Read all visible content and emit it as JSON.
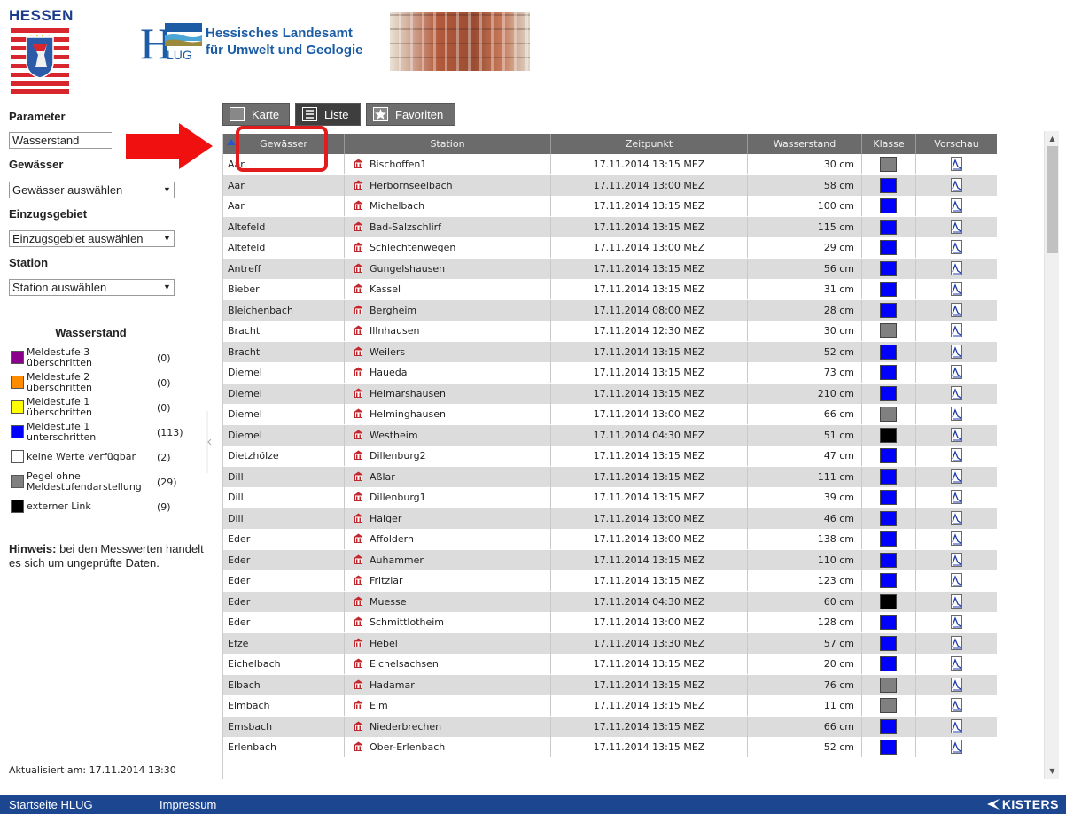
{
  "header": {
    "state_name": "HESSEN",
    "agency_abbrev_main": "H",
    "agency_abbrev_sub": "LUG",
    "agency_name_line1": "Hessisches Landesamt",
    "agency_name_line2": "für Umwelt und Geologie"
  },
  "sidebar": {
    "parameter_label": "Parameter",
    "parameter_value": "Wasserstand",
    "gewaesser_label": "Gewässer",
    "gewaesser_value": "Gewässer auswählen",
    "einzugsgebiet_label": "Einzugsgebiet",
    "einzugsgebiet_value": "Einzugsgebiet auswählen",
    "station_label": "Station",
    "station_value": "Station auswählen",
    "legend_title": "Wasserstand",
    "legend": [
      {
        "line1": "Meldestufe 3",
        "line2": "überschritten",
        "count": "(0)",
        "color": "#8b008b"
      },
      {
        "line1": "Meldestufe 2",
        "line2": "überschritten",
        "count": "(0)",
        "color": "#ff8c00"
      },
      {
        "line1": "Meldestufe 1",
        "line2": "überschritten",
        "count": "(0)",
        "color": "#ffff00"
      },
      {
        "line1": "Meldestufe 1",
        "line2": "unterschritten",
        "count": "(113)",
        "color": "#0000ff"
      },
      {
        "line1": "keine Werte verfügbar",
        "line2": "",
        "count": "(2)",
        "color": "#ffffff"
      },
      {
        "line1": "Pegel ohne",
        "line2": "Meldestufendarstellung",
        "count": "(29)",
        "color": "#808080"
      },
      {
        "line1": "externer Link",
        "line2": "",
        "count": "(9)",
        "color": "#000000"
      }
    ],
    "hinweis_label": "Hinweis:",
    "hinweis_text": "bei den Messwerten handelt es sich um ungeprüfte Daten.",
    "updated": "Aktualisiert am: 17.11.2014  13:30"
  },
  "tabs": [
    {
      "label": "Karte"
    },
    {
      "label": "Liste"
    },
    {
      "label": "Favoriten"
    }
  ],
  "table": {
    "headers": [
      "Gewässer",
      "Station",
      "Zeitpunkt",
      "Wasserstand",
      "Klasse",
      "Vorschau"
    ],
    "rows": [
      {
        "gew": "Aar",
        "station": "Bischoffen1",
        "zeit": "17.11.2014 13:15 MEZ",
        "ws": "30 cm",
        "klasse": "#808080"
      },
      {
        "gew": "Aar",
        "station": "Herbornseelbach",
        "zeit": "17.11.2014 13:00 MEZ",
        "ws": "58 cm",
        "klasse": "#0000ff"
      },
      {
        "gew": "Aar",
        "station": "Michelbach",
        "zeit": "17.11.2014 13:15 MEZ",
        "ws": "100 cm",
        "klasse": "#0000ff"
      },
      {
        "gew": "Altefeld",
        "station": "Bad-Salzschlirf",
        "zeit": "17.11.2014 13:15 MEZ",
        "ws": "115 cm",
        "klasse": "#0000ff"
      },
      {
        "gew": "Altefeld",
        "station": "Schlechtenwegen",
        "zeit": "17.11.2014 13:00 MEZ",
        "ws": "29 cm",
        "klasse": "#0000ff"
      },
      {
        "gew": "Antreff",
        "station": "Gungelshausen",
        "zeit": "17.11.2014 13:15 MEZ",
        "ws": "56 cm",
        "klasse": "#0000ff"
      },
      {
        "gew": "Bieber",
        "station": "Kassel",
        "zeit": "17.11.2014 13:15 MEZ",
        "ws": "31 cm",
        "klasse": "#0000ff"
      },
      {
        "gew": "Bleichenbach",
        "station": "Bergheim",
        "zeit": "17.11.2014 08:00 MEZ",
        "ws": "28 cm",
        "klasse": "#0000ff"
      },
      {
        "gew": "Bracht",
        "station": "Illnhausen",
        "zeit": "17.11.2014 12:30 MEZ",
        "ws": "30 cm",
        "klasse": "#808080"
      },
      {
        "gew": "Bracht",
        "station": "Weilers",
        "zeit": "17.11.2014 13:15 MEZ",
        "ws": "52 cm",
        "klasse": "#0000ff"
      },
      {
        "gew": "Diemel",
        "station": "Haueda",
        "zeit": "17.11.2014 13:15 MEZ",
        "ws": "73 cm",
        "klasse": "#0000ff"
      },
      {
        "gew": "Diemel",
        "station": "Helmarshausen",
        "zeit": "17.11.2014 13:15 MEZ",
        "ws": "210 cm",
        "klasse": "#0000ff"
      },
      {
        "gew": "Diemel",
        "station": "Helminghausen",
        "zeit": "17.11.2014 13:00 MEZ",
        "ws": "66 cm",
        "klasse": "#808080"
      },
      {
        "gew": "Diemel",
        "station": "Westheim",
        "zeit": "17.11.2014 04:30 MEZ",
        "ws": "51 cm",
        "klasse": "#000000"
      },
      {
        "gew": "Dietzhölze",
        "station": "Dillenburg2",
        "zeit": "17.11.2014 13:15 MEZ",
        "ws": "47 cm",
        "klasse": "#0000ff"
      },
      {
        "gew": "Dill",
        "station": "Aßlar",
        "zeit": "17.11.2014 13:15 MEZ",
        "ws": "111 cm",
        "klasse": "#0000ff"
      },
      {
        "gew": "Dill",
        "station": "Dillenburg1",
        "zeit": "17.11.2014 13:15 MEZ",
        "ws": "39 cm",
        "klasse": "#0000ff"
      },
      {
        "gew": "Dill",
        "station": "Haiger",
        "zeit": "17.11.2014 13:00 MEZ",
        "ws": "46 cm",
        "klasse": "#0000ff"
      },
      {
        "gew": "Eder",
        "station": "Affoldern",
        "zeit": "17.11.2014 13:00 MEZ",
        "ws": "138 cm",
        "klasse": "#0000ff"
      },
      {
        "gew": "Eder",
        "station": "Auhammer",
        "zeit": "17.11.2014 13:15 MEZ",
        "ws": "110 cm",
        "klasse": "#0000ff"
      },
      {
        "gew": "Eder",
        "station": "Fritzlar",
        "zeit": "17.11.2014 13:15 MEZ",
        "ws": "123 cm",
        "klasse": "#0000ff"
      },
      {
        "gew": "Eder",
        "station": "Muesse",
        "zeit": "17.11.2014 04:30 MEZ",
        "ws": "60 cm",
        "klasse": "#000000"
      },
      {
        "gew": "Eder",
        "station": "Schmittlotheim",
        "zeit": "17.11.2014 13:00 MEZ",
        "ws": "128 cm",
        "klasse": "#0000ff"
      },
      {
        "gew": "Efze",
        "station": "Hebel",
        "zeit": "17.11.2014 13:30 MEZ",
        "ws": "57 cm",
        "klasse": "#0000ff"
      },
      {
        "gew": "Eichelbach",
        "station": "Eichelsachsen",
        "zeit": "17.11.2014 13:15 MEZ",
        "ws": "20 cm",
        "klasse": "#0000ff"
      },
      {
        "gew": "Elbach",
        "station": "Hadamar",
        "zeit": "17.11.2014 13:15 MEZ",
        "ws": "76 cm",
        "klasse": "#808080"
      },
      {
        "gew": "Elmbach",
        "station": "Elm",
        "zeit": "17.11.2014 13:15 MEZ",
        "ws": "11 cm",
        "klasse": "#808080"
      },
      {
        "gew": "Emsbach",
        "station": "Niederbrechen",
        "zeit": "17.11.2014 13:15 MEZ",
        "ws": "66 cm",
        "klasse": "#0000ff"
      },
      {
        "gew": "Erlenbach",
        "station": "Ober-Erlenbach",
        "zeit": "17.11.2014 13:15 MEZ",
        "ws": "52 cm",
        "klasse": "#0000ff"
      }
    ]
  },
  "footer": {
    "home_link": "Startseite HLUG",
    "impressum_link": "Impressum",
    "vendor": "KISTERS"
  }
}
